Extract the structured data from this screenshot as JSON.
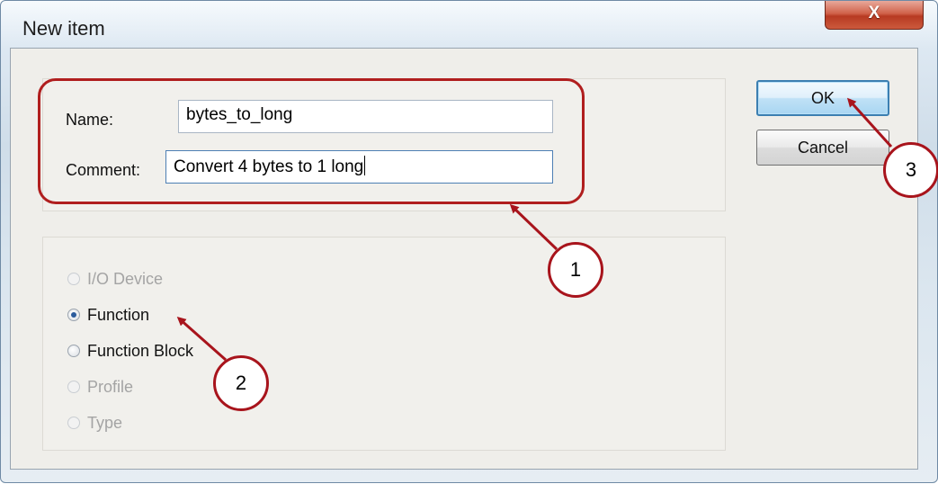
{
  "window": {
    "title": "New item",
    "close_label": "X"
  },
  "form": {
    "name_label": "Name:",
    "name_value": "bytes_to_long",
    "comment_label": "Comment:",
    "comment_value": "Convert 4 bytes to 1 long"
  },
  "type_options": [
    {
      "label": "I/O Device",
      "checked": false,
      "enabled": false
    },
    {
      "label": "Function",
      "checked": true,
      "enabled": true
    },
    {
      "label": "Function Block",
      "checked": false,
      "enabled": true
    },
    {
      "label": "Profile",
      "checked": false,
      "enabled": false
    },
    {
      "label": "Type",
      "checked": false,
      "enabled": false
    }
  ],
  "buttons": {
    "ok": "OK",
    "cancel": "Cancel"
  },
  "annotations": {
    "callout_1": "1",
    "callout_2": "2",
    "callout_3": "3",
    "color": "#a8141c"
  }
}
